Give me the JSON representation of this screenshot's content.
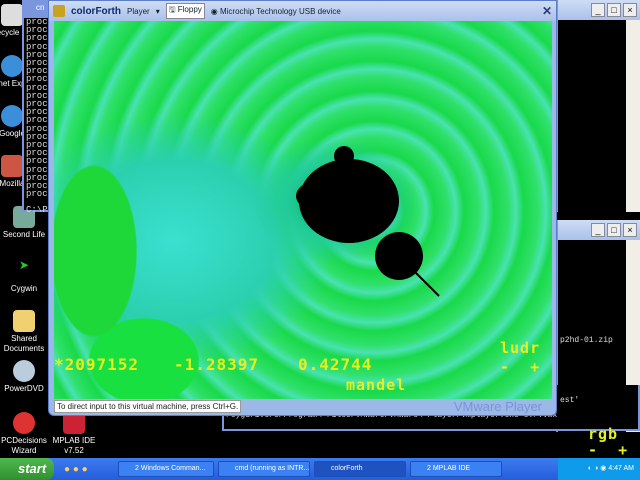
{
  "desktop": {
    "icons": [
      {
        "label": "Recycle Bin"
      },
      {
        "label": "Internet Explorer"
      },
      {
        "label": "Google"
      },
      {
        "label": "Mozilla"
      },
      {
        "label": "Second Life"
      },
      {
        "label": "Cygwin"
      },
      {
        "label": "Shared Documents"
      },
      {
        "label": "PowerDVD"
      },
      {
        "label": "PCDecisions Wizard"
      },
      {
        "label": "MPLAB IDE v7.52"
      }
    ]
  },
  "console_left": {
    "title": "cn",
    "line": "proce",
    "prompt": "C:\\Pr"
  },
  "vmware": {
    "title": "colorForth",
    "player_menu": "Player",
    "floppy": "Floppy",
    "usb_device": "Microchip Technology USB device",
    "status_hint": "To direct input to this virtual machine, press Ctrl+G.",
    "brand": "VMware Player"
  },
  "colorforth": {
    "zoom": "*2097152",
    "x": "-1.28397",
    "y": "0.42744",
    "word": "mandel",
    "keys_top": "ludr",
    "keys_bottom": "-  +",
    "rgb": "rgb",
    "rgb_keys": "-  +"
  },
  "lower_console": {
    "lines": [
      "p2hd-01.zip",
      "est'",
      "/cygdrive/c/Program\\ Files/VMware/VMware\\ Player/vmplayer.exe c:/.vmx"
    ]
  },
  "taskbar": {
    "start": "start",
    "buttons": [
      "2 Windows Comman...",
      "cmd (running as INTR...",
      "colorForth",
      "2 MPLAB IDE"
    ],
    "clock": "4:47 AM"
  }
}
